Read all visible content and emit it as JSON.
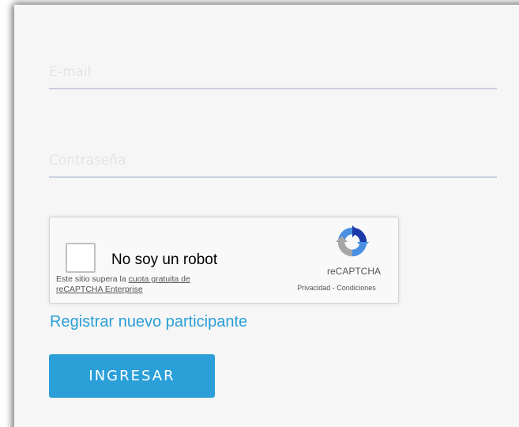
{
  "form": {
    "email_placeholder": "E-mail",
    "password_placeholder": "Contraseña"
  },
  "captcha": {
    "checkbox_label": "No soy un robot",
    "note_prefix": "Este sitio supera la ",
    "note_link": "cuota gratuita de reCAPTCHA Enterprise",
    "brand": "reCAPTCHA",
    "privacy": "Privacidad",
    "separator": " - ",
    "terms": "Condiciones",
    "checked": false
  },
  "register_link": "Registrar nuevo participante",
  "submit_label": "INGRESAR",
  "colors": {
    "accent": "#2a9fd8",
    "background": "#f6f6f6",
    "field_underline": "#c9cfdf"
  },
  "icons": {
    "captcha_logo": "recaptcha-logo-icon"
  }
}
